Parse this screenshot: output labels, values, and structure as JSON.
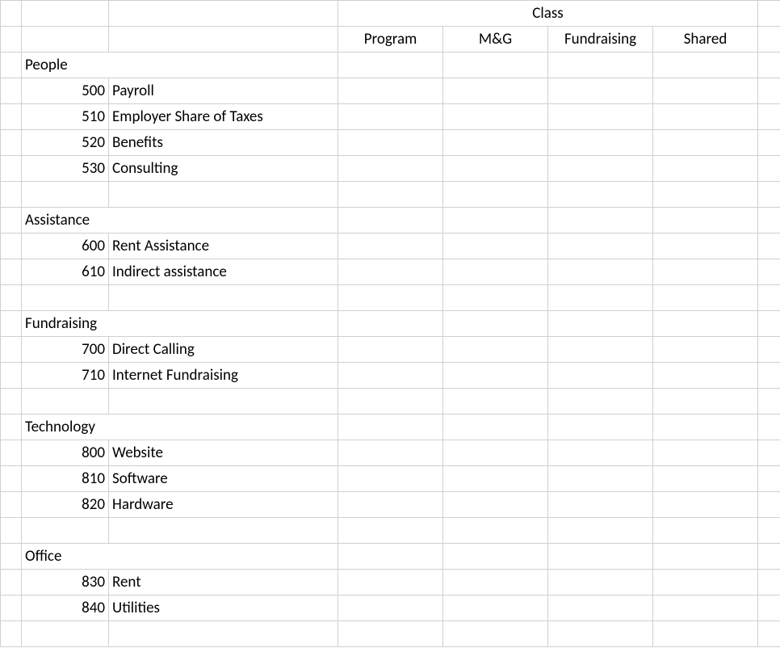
{
  "header": {
    "class_label": "Class",
    "columns": [
      "Program",
      "M&G",
      "Fundraising",
      "Shared"
    ]
  },
  "sections": [
    {
      "name": "People",
      "items": [
        {
          "code": "500",
          "label": "Payroll"
        },
        {
          "code": "510",
          "label": "Employer Share of Taxes"
        },
        {
          "code": "520",
          "label": "Benefits"
        },
        {
          "code": "530",
          "label": "Consulting"
        }
      ]
    },
    {
      "name": "Assistance",
      "items": [
        {
          "code": "600",
          "label": "Rent Assistance"
        },
        {
          "code": "610",
          "label": "Indirect assistance"
        }
      ]
    },
    {
      "name": "Fundraising",
      "items": [
        {
          "code": "700",
          "label": "Direct Calling"
        },
        {
          "code": "710",
          "label": "Internet Fundraising"
        }
      ]
    },
    {
      "name": "Technology",
      "items": [
        {
          "code": "800",
          "label": "Website"
        },
        {
          "code": "810",
          "label": "Software"
        },
        {
          "code": "820",
          "label": "Hardware"
        }
      ]
    },
    {
      "name": "Office",
      "items": [
        {
          "code": "830",
          "label": "Rent"
        },
        {
          "code": "840",
          "label": "Utilities"
        }
      ]
    }
  ]
}
